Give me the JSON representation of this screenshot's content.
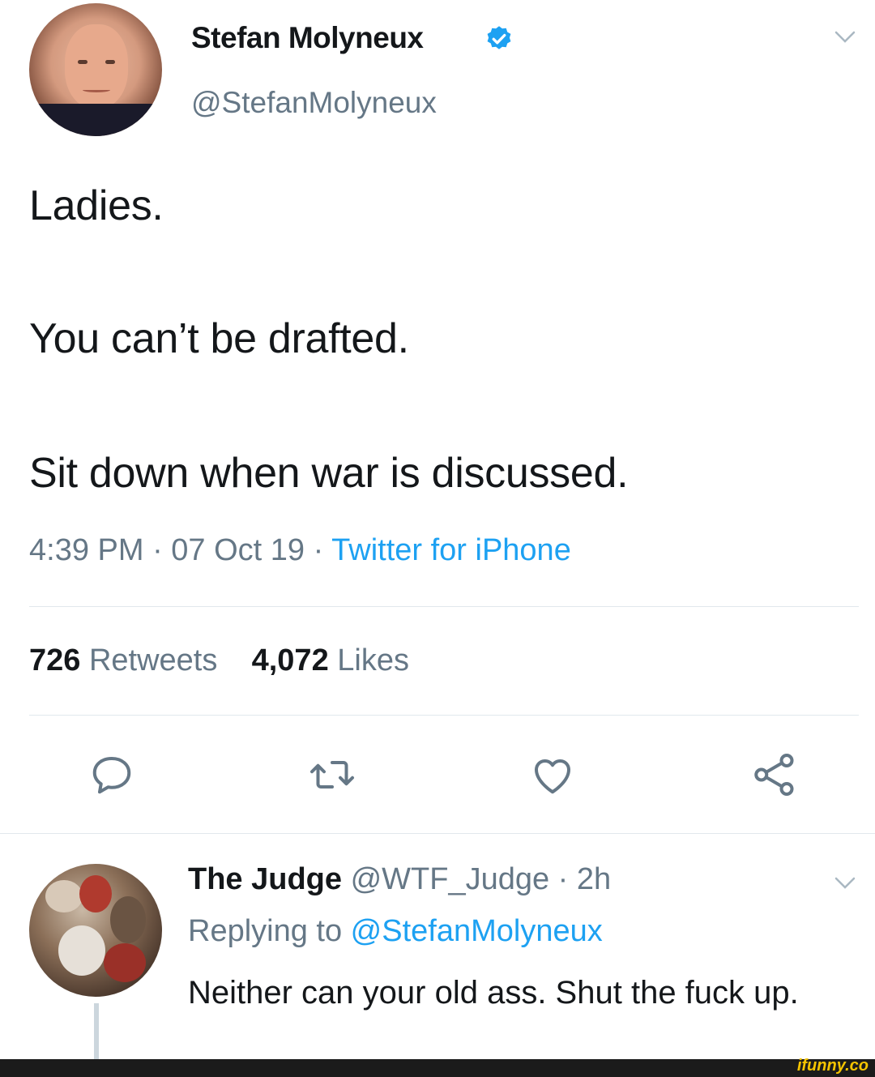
{
  "tweet": {
    "author_name": "Stefan Molyneux",
    "author_handle": "@StefanMolyneux",
    "lines": [
      "Ladies.",
      "You can’t be drafted.",
      "Sit down when war is discussed."
    ],
    "timestamp": "4:39 PM · 07 Oct 19 · ",
    "source": "Twitter for iPhone",
    "retweets_count": "726",
    "retweets_label": " Retweets",
    "likes_count": "4,072",
    "likes_label": " Likes",
    "verified_icon": "verified-badge-icon",
    "actions": [
      "reply-icon",
      "retweet-icon",
      "like-icon",
      "share-icon"
    ]
  },
  "reply": {
    "author_name": "The Judge",
    "author_meta": " @WTF_Judge · 2h",
    "replying_prefix": "Replying to ",
    "replying_to": "@StefanMolyneux",
    "text": "Neither can your old ass. Shut the fuck up."
  },
  "watermark": "ifunny.co",
  "colors": {
    "accent": "#1da1f2",
    "secondary_text": "#657786",
    "primary_text": "#14171a"
  }
}
